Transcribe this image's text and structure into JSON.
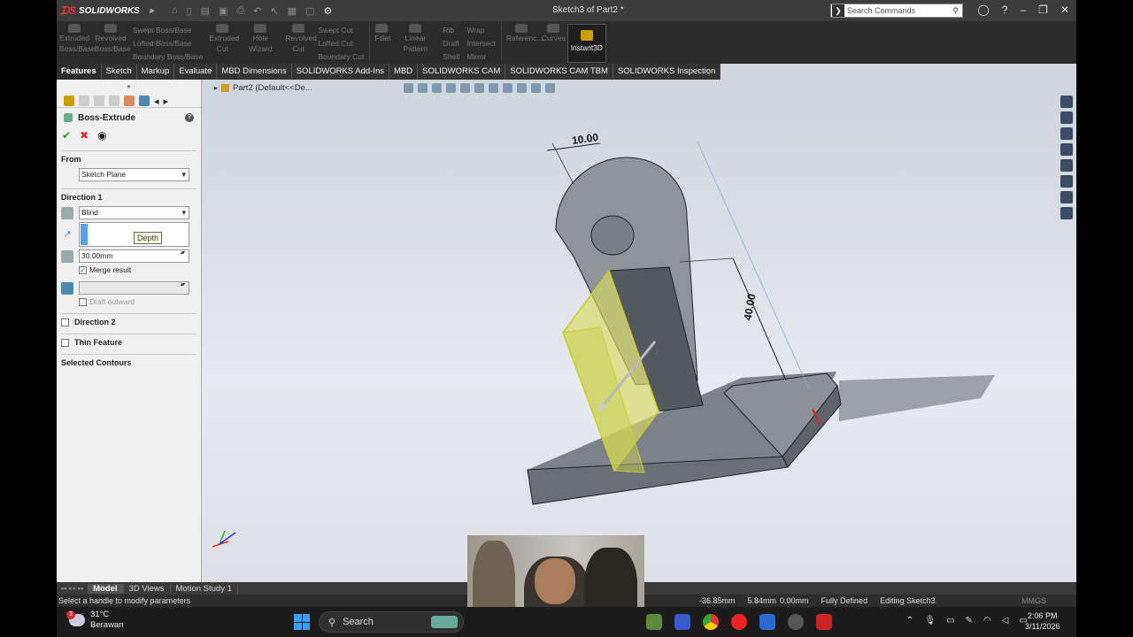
{
  "titlebar": {
    "app_name": "SOLIDWORKS",
    "document_title": "Sketch3 of Part2 *",
    "search_placeholder": "Search Commands"
  },
  "command_manager": {
    "extruded_boss": "Extruded Boss/Base",
    "revolved_boss": "Revolved Boss/Base",
    "swept_boss": "Swept Boss/Base",
    "lofted_boss": "Lofted Boss/Base",
    "boundary_boss": "Boundary Boss/Base",
    "extruded_cut": "Extruded Cut",
    "hole_wizard": "Hole Wizard",
    "revolved_cut": "Revolved Cut",
    "swept_cut": "Swept Cut",
    "lofted_cut": "Lofted Cut",
    "boundary_cut": "Boundary Cut",
    "fillet": "Fillet",
    "linear_pattern": "Linear Pattern",
    "rib": "Rib",
    "draft": "Draft",
    "shell": "Shell",
    "wrap": "Wrap",
    "intersect": "Intersect",
    "mirror": "Mirror",
    "reference": "Referenc...",
    "curves": "Curves",
    "instant3d": "Instant3D"
  },
  "tabs": [
    {
      "label": "Features"
    },
    {
      "label": "Sketch"
    },
    {
      "label": "Markup"
    },
    {
      "label": "Evaluate"
    },
    {
      "label": "MBD Dimensions"
    },
    {
      "label": "SOLIDWORKS Add-Ins"
    },
    {
      "label": "MBD"
    },
    {
      "label": "SOLIDWORKS CAM"
    },
    {
      "label": "SOLIDWORKS CAM TBM"
    },
    {
      "label": "SOLIDWORKS Inspection"
    }
  ],
  "property_manager": {
    "title": "Boss-Extrude",
    "from_label": "From",
    "from_value": "Sketch Plane",
    "direction1_label": "Direction 1",
    "end_condition": "Blind",
    "tooltip": "Depth",
    "depth_value": "30.00mm",
    "merge_result": "Merge result",
    "draft_outward": "Draft outward",
    "direction2_label": "Direction 2",
    "thin_feature_label": "Thin Feature",
    "selected_contours_label": "Selected Contours"
  },
  "viewport": {
    "breadcrumb": "Part2  (Default<<De...",
    "dim_1": "10.00",
    "dim_2": "40.00"
  },
  "bottom_tabs": [
    {
      "label": "Model"
    },
    {
      "label": "3D Views"
    },
    {
      "label": "Motion Study 1"
    }
  ],
  "statusbar": {
    "message": "Select a handle to modify parameters",
    "x_coord": "-36.85mm",
    "y_coord": "5.84mm",
    "z_coord": "0.00mm",
    "sketch_state": "Fully Defined",
    "editing": "Editing Sketch3",
    "units": "MMGS"
  },
  "taskbar": {
    "temperature": "31°C",
    "weather": "Berawan",
    "weather_badge": "3",
    "search_label": "Search",
    "time": "2:06 PM",
    "date": "3/11/2026"
  },
  "colors": {
    "accent": "#5aa0e6",
    "selection_yellow": "#d9e05a",
    "ok_green": "#2a9a2a",
    "cancel_red": "#cc3333"
  }
}
